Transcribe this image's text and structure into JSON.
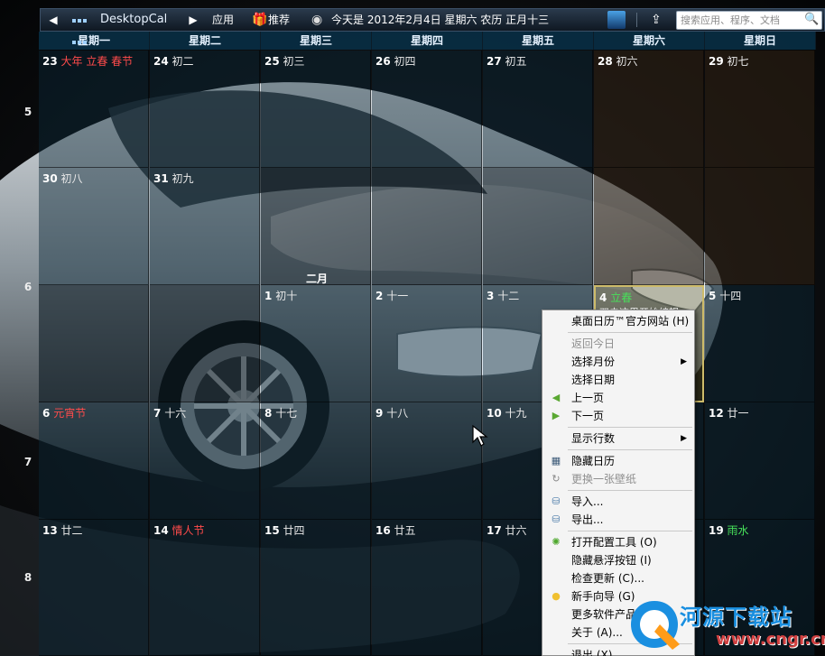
{
  "topbar": {
    "title": "DesktopCal",
    "apps": "应用",
    "recommend": "推荐",
    "today": "今天是 2012年2月4日 星期六 农历 正月十三",
    "search_placeholder": "搜索应用、程序、文档"
  },
  "calendar": {
    "weekdays": [
      "星期一",
      "星期二",
      "星期三",
      "星期四",
      "星期五",
      "星期六",
      "星期日"
    ],
    "week_numbers": [
      "5",
      "6",
      "7",
      "8"
    ],
    "month_label": "二月",
    "rows": [
      [
        {
          "d": "23",
          "l": "大年 立春 春节",
          "c": "red"
        },
        {
          "d": "24",
          "l": "初二"
        },
        {
          "d": "25",
          "l": "初三"
        },
        {
          "d": "26",
          "l": "初四"
        },
        {
          "d": "27",
          "l": "初五"
        },
        {
          "d": "28",
          "l": "初六"
        },
        {
          "d": "29",
          "l": "初七"
        }
      ],
      [
        {
          "d": "30",
          "l": "初八"
        },
        {
          "d": "31",
          "l": "初九"
        },
        {
          "d": "",
          "l": ""
        },
        {
          "d": "",
          "l": ""
        },
        {
          "d": "",
          "l": ""
        },
        {
          "d": "",
          "l": ""
        },
        {
          "d": "",
          "l": ""
        }
      ],
      [
        {
          "d": "",
          "l": ""
        },
        {
          "d": "",
          "l": ""
        },
        {
          "d": "1",
          "l": "初十"
        },
        {
          "d": "2",
          "l": "十一"
        },
        {
          "d": "3",
          "l": "十二"
        },
        {
          "d": "4",
          "l": "立春",
          "c": "green",
          "note": "双击这里开始编辑"
        },
        {
          "d": "5",
          "l": "十四"
        }
      ],
      [
        {
          "d": "6",
          "l": "元宵节",
          "c": "red"
        },
        {
          "d": "7",
          "l": "十六"
        },
        {
          "d": "8",
          "l": "十七"
        },
        {
          "d": "9",
          "l": "十八"
        },
        {
          "d": "10",
          "l": "十九"
        },
        {
          "d": "",
          "l": ""
        },
        {
          "d": "12",
          "l": "廿一"
        }
      ],
      [
        {
          "d": "13",
          "l": "廿二"
        },
        {
          "d": "14",
          "l": "情人节",
          "c": "red"
        },
        {
          "d": "15",
          "l": "廿四"
        },
        {
          "d": "16",
          "l": "廿五"
        },
        {
          "d": "17",
          "l": "廿六"
        },
        {
          "d": "",
          "l": ""
        },
        {
          "d": "19",
          "l": "雨水",
          "c": "green"
        }
      ]
    ]
  },
  "context_menu": {
    "items": [
      {
        "label": "桌面日历™官方网站 (H)",
        "icon": ""
      },
      {
        "sep": true
      },
      {
        "label": "返回今日",
        "disabled": true
      },
      {
        "label": "选择月份",
        "submenu": true
      },
      {
        "label": "选择日期"
      },
      {
        "label": "上一页",
        "icon": "left-arrow-icon"
      },
      {
        "label": "下一页",
        "icon": "right-arrow-icon"
      },
      {
        "sep": true
      },
      {
        "label": "显示行数",
        "submenu": true
      },
      {
        "sep": true
      },
      {
        "label": "隐藏日历",
        "icon": "calendar-icon"
      },
      {
        "label": "更换一张壁纸",
        "disabled": true,
        "icon": "refresh-icon"
      },
      {
        "sep": true
      },
      {
        "label": "导入...",
        "icon": "database-import-icon"
      },
      {
        "label": "导出...",
        "icon": "database-export-icon"
      },
      {
        "sep": true
      },
      {
        "label": "打开配置工具 (O)",
        "icon": "gear-icon"
      },
      {
        "label": "隐藏悬浮按钮 (I)"
      },
      {
        "label": "检查更新 (C)..."
      },
      {
        "label": "新手向导 (G)",
        "icon": "lightbulb-icon"
      },
      {
        "label": "更多软件产品 (M)"
      },
      {
        "label": "关于 (A)..."
      },
      {
        "sep": true
      },
      {
        "label": "退出 (X)"
      }
    ]
  },
  "watermark": {
    "title": "河源下载站",
    "subtitle": "www.cngr.cn"
  },
  "colors": {
    "holiday": "#ff4b4b",
    "solar_term": "#47e05a",
    "today_border": "#cdbb6a"
  }
}
